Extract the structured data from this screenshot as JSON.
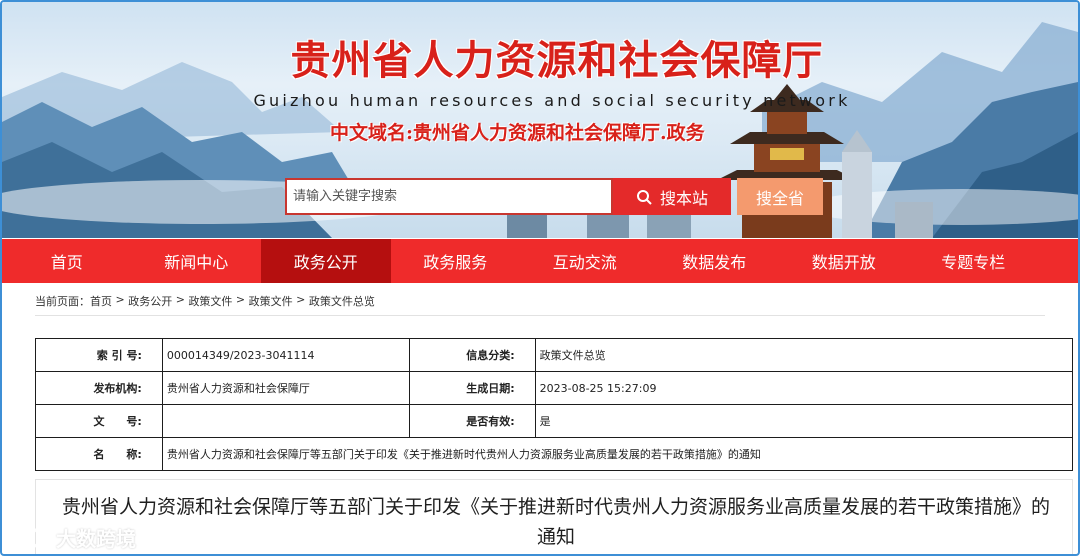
{
  "header": {
    "title": "贵州省人力资源和社会保障厅",
    "subtitle": "Guizhou human resources and social security network",
    "domain": "中文域名:贵州省人力资源和社会保障厅.政务"
  },
  "search": {
    "placeholder": "请输入关键字搜索",
    "site_button": "搜本站",
    "province_button": "搜全省"
  },
  "nav": {
    "items": [
      {
        "label": "首页"
      },
      {
        "label": "新闻中心"
      },
      {
        "label": "政务公开"
      },
      {
        "label": "政务服务"
      },
      {
        "label": "互动交流"
      },
      {
        "label": "数据发布"
      },
      {
        "label": "数据开放"
      },
      {
        "label": "专题专栏"
      }
    ],
    "active": "政务公开"
  },
  "breadcrumb": {
    "prefix": "当前页面：",
    "items": [
      "首页",
      "政务公开",
      "政策文件",
      "政策文件",
      "政策文件总览"
    ],
    "separator": " > "
  },
  "info": {
    "index_label": "索 引 号:",
    "index_value": "000014349/2023-3041114",
    "category_label": "信息分类:",
    "category_value": "政策文件总览",
    "publisher_label": "发布机构:",
    "publisher_value": "贵州省人力资源和社会保障厅",
    "date_label": "生成日期:",
    "date_value": "2023-08-25 15:27:09",
    "docno_label": "文　　号:",
    "docno_value": "",
    "valid_label": "是否有效:",
    "valid_value": "是",
    "name_label": "名　　称:",
    "name_value": "贵州省人力资源和社会保障厅等五部门关于印发《关于推进新时代贵州人力资源服务业高质量发展的若干政策措施》的通知"
  },
  "article": {
    "title": "贵州省人力资源和社会保障厅等五部门关于印发《关于推进新时代贵州人力资源服务业高质量发展的若干政策措施》的通知"
  },
  "watermark": {
    "text": "大数跨境"
  },
  "colors": {
    "nav_bg": "#ef2b2b",
    "nav_active": "#b50f0f",
    "title_red": "#d8211a",
    "search_button": "#e42a2a",
    "province_button": "#f49a6e",
    "frame_border": "#3d8fd6"
  }
}
